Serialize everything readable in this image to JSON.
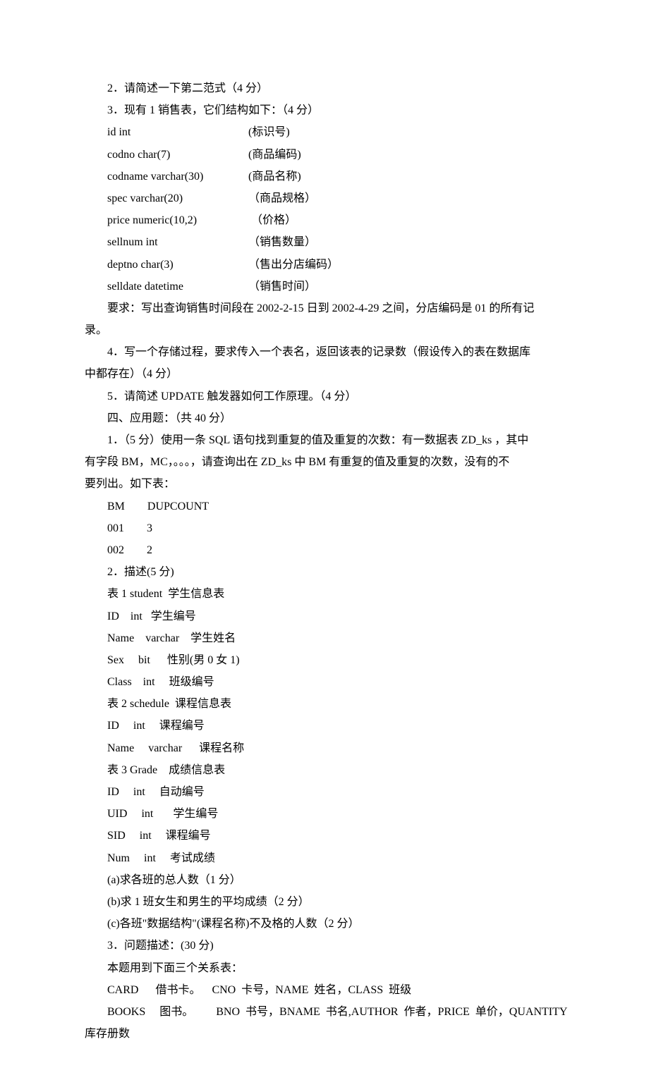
{
  "q2": "2．请简述一下第二范式（4 分）",
  "q3": "3．现有 1 销售表，它们结构如下：（4 分）",
  "fields": [
    {
      "name": "id int",
      "desc": "(标识号)"
    },
    {
      "name": "codno char(7)",
      "desc": "(商品编码)"
    },
    {
      "name": "codname varchar(30)",
      "desc": "(商品名称)"
    },
    {
      "name": "spec varchar(20)",
      "desc": "（商品规格）"
    },
    {
      "name": "price numeric(10,2)",
      "desc": " （价格）"
    },
    {
      "name": "sellnum int",
      "desc": "（销售数量）"
    },
    {
      "name": "deptno char(3)",
      "desc": "（售出分店编码）"
    },
    {
      "name": "selldate datetime",
      "desc": "（销售时间）"
    }
  ],
  "q3_req_a": "要求：写出查询销售时间段在 2002-2-15 日到 2002-4-29 之间，分店编码是 01 的所有记",
  "q3_req_b": "录。",
  "q4_a": "4．写一个存储过程，要求传入一个表名，返回该表的记录数（假设传入的表在数据库",
  "q4_b": "中都存在）（4 分）",
  "q5": "5．请简述 UPDATE 触发器如何工作原理。（4 分）",
  "sec4_title": "四、应用题：（共 40 分）",
  "s4_q1_a": "1．（5 分）使用一条 SQL 语句找到重复的值及重复的次数：有一数据表 ZD_ks ，其中",
  "s4_q1_b": "有字段 BM，MC，。。。，请查询出在 ZD_ks 中 BM 有重复的值及重复的次数，没有的不",
  "s4_q1_c": "要列出。如下表：",
  "s4_q1_header": "BM        DUPCOUNT",
  "s4_q1_r1": "001        3",
  "s4_q1_r2": "002        2",
  "s4_q2": "2．描述(5 分)",
  "s4_t1": "表 1 student  学生信息表",
  "s4_t1_f1": "ID    int   学生编号",
  "s4_t1_f2": "Name    varchar    学生姓名",
  "s4_t1_f3": "Sex     bit      性别(男 0 女 1)",
  "s4_t1_f4": "Class    int     班级编号",
  "s4_t2": "表 2 schedule  课程信息表",
  "s4_t2_f1": "ID     int     课程编号",
  "s4_t2_f2": "Name     varchar      课程名称",
  "s4_t3": "表 3 Grade    成绩信息表",
  "s4_t3_f1": "ID     int     自动编号",
  "s4_t3_f2": "UID     int       学生编号",
  "s4_t3_f3": "SID     int     课程编号",
  "s4_t3_f4": "Num     int     考试成绩",
  "s4_qa": "(a)求各班的总人数（1 分）",
  "s4_qb": "(b)求 1 班女生和男生的平均成绩（2 分）",
  "s4_qc": "(c)各班\"数据结构\"(课程名称)不及格的人数（2 分）",
  "s4_q3": "3．问题描述：(30 分)",
  "s4_q3_intro": "本题用到下面三个关系表：",
  "s4_q3_card": "CARD      借书卡。    CNO  卡号，NAME  姓名，CLASS  班级",
  "s4_q3_books_a": "BOOKS     图书。        BNO  书号，BNAME  书名,AUTHOR  作者，PRICE  单价，QUANTITY",
  "s4_q3_books_b": "库存册数"
}
